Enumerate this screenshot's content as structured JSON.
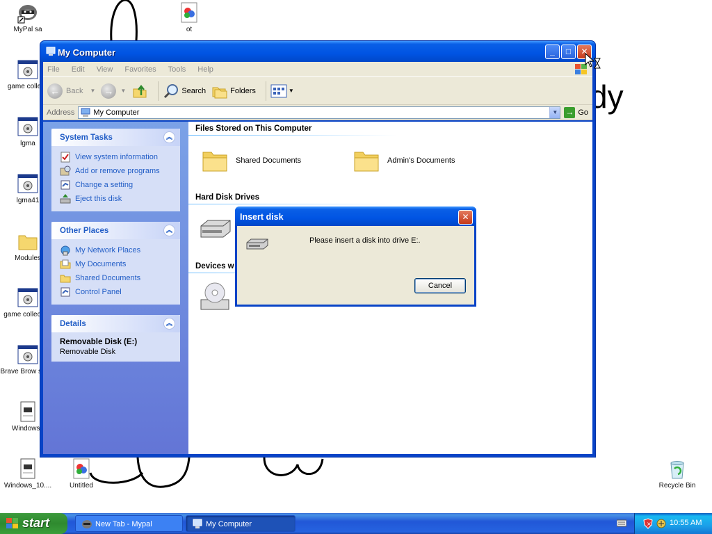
{
  "desktop": {
    "icons": [
      {
        "label": "MyPal sa",
        "icon": "raccoon-shortcut-icon"
      },
      {
        "label": "ot",
        "icon": "paint-file-icon"
      },
      {
        "label": "game collecti",
        "icon": "executable-icon"
      },
      {
        "label": "lgma",
        "icon": "executable-icon"
      },
      {
        "label": "lgma41",
        "icon": "executable-icon"
      },
      {
        "label": "Modules",
        "icon": "folder-icon"
      },
      {
        "label": "game collection",
        "icon": "executable-icon"
      },
      {
        "label": "Brave Brow setup",
        "icon": "executable-icon"
      },
      {
        "label": "Windows_",
        "icon": "text-file-icon"
      },
      {
        "label": "Windows_10....",
        "icon": "text-file-icon"
      },
      {
        "label": "Untitled",
        "icon": "paint-file-icon"
      },
      {
        "label": "Recycle Bin",
        "icon": "recycle-bin-icon"
      }
    ],
    "background_text": "dy"
  },
  "window": {
    "title": "My Computer",
    "menu": [
      "File",
      "Edit",
      "View",
      "Favorites",
      "Tools",
      "Help"
    ],
    "toolbar": {
      "back": "Back",
      "search": "Search",
      "folders": "Folders"
    },
    "address": {
      "label": "Address",
      "value": "My Computer",
      "go": "Go"
    },
    "taskpane": {
      "system_tasks": {
        "title": "System Tasks",
        "items": [
          "View system information",
          "Add or remove programs",
          "Change a setting",
          "Eject this disk"
        ]
      },
      "other_places": {
        "title": "Other Places",
        "items": [
          "My Network Places",
          "My Documents",
          "Shared Documents",
          "Control Panel"
        ]
      },
      "details": {
        "title": "Details",
        "name": "Removable Disk (E:)",
        "type": "Removable Disk"
      }
    },
    "content": {
      "files_stored": {
        "title": "Files Stored on This Computer",
        "items": [
          "Shared Documents",
          "Admin's Documents"
        ]
      },
      "hard_disks": {
        "title": "Hard Disk Drives"
      },
      "devices": {
        "title": "Devices w"
      }
    }
  },
  "dialog": {
    "title": "Insert disk",
    "message": "Please insert a disk into drive E:.",
    "cancel": "Cancel"
  },
  "taskbar": {
    "start": "start",
    "tasks": [
      "New Tab - Mypal",
      "My Computer"
    ],
    "clock": "10:55 AM"
  },
  "colors": {
    "xp_blue": "#0054e3",
    "taskpane_link": "#215dc6",
    "start_green": "#3c9a3c",
    "close_red": "#c63a1a"
  }
}
